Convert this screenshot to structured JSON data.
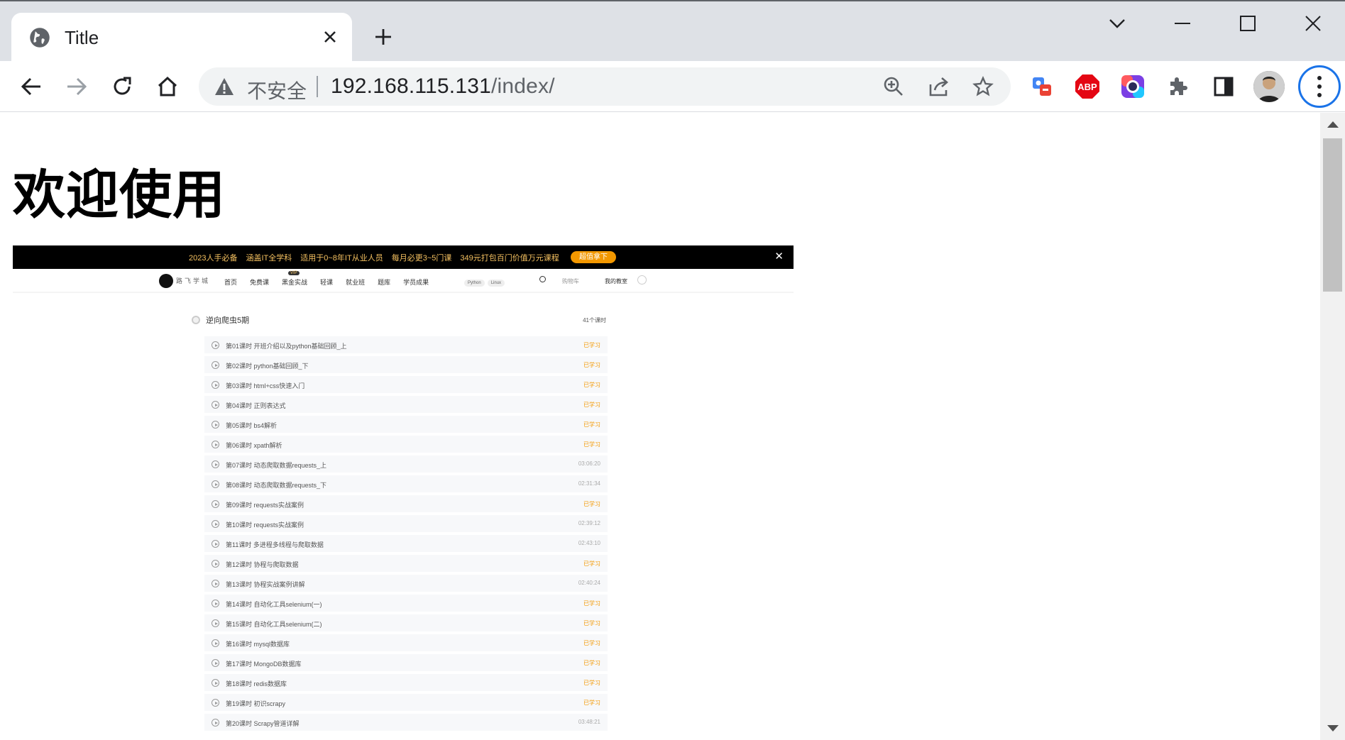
{
  "browser": {
    "tab_title": "Title",
    "omnibox": {
      "security_label": "不安全",
      "url_host": "192.168.115.131",
      "url_path": "/index/"
    },
    "extensions": [
      "translate-extension-icon",
      "adblock-plus-icon",
      "screen-capture-extension-icon",
      "extensions-puzzle-icon"
    ],
    "ext_abp_label": "ABP"
  },
  "page": {
    "heading": "欢迎使用",
    "embedded": {
      "promo": {
        "items": [
          "2023人手必备",
          "涵盖IT全学科",
          "适用于0~8年IT从业人员",
          "每月必更3~5门课",
          "349元打包百门价值万元课程"
        ],
        "cta": "超值拿下",
        "close": "✕"
      },
      "nav": {
        "logo_text": "路飞学城",
        "menu": [
          "首页",
          "免费课",
          "黑金实战",
          "轻课",
          "就业班",
          "题库",
          "学员成果"
        ],
        "vip": "VIP",
        "search_chips": [
          "Python",
          "Linux"
        ],
        "cart": "购物车",
        "my_classroom": "我的教室"
      },
      "course": {
        "title": "逆向爬虫5期",
        "count": "41个课时",
        "lessons": [
          {
            "title": "第01课时 开班介绍以及python基础回顾_上",
            "status": "已学习",
            "done": true
          },
          {
            "title": "第02课时 python基础回顾_下",
            "status": "已学习",
            "done": true
          },
          {
            "title": "第03课时 html+css快速入门",
            "status": "已学习",
            "done": true
          },
          {
            "title": "第04课时 正则表达式",
            "status": "已学习",
            "done": true
          },
          {
            "title": "第05课时 bs4解析",
            "status": "已学习",
            "done": true
          },
          {
            "title": "第06课时 xpath解析",
            "status": "已学习",
            "done": true
          },
          {
            "title": "第07课时 动态爬取数据requests_上",
            "status": "03:06:20",
            "done": false
          },
          {
            "title": "第08课时 动态爬取数据requests_下",
            "status": "02:31:34",
            "done": false
          },
          {
            "title": "第09课时 requests实战案例",
            "status": "已学习",
            "done": true
          },
          {
            "title": "第10课时 requests实战案例",
            "status": "02:39:12",
            "done": false
          },
          {
            "title": "第11课时 多进程多线程与爬取数据",
            "status": "02:43:10",
            "done": false
          },
          {
            "title": "第12课时 协程与爬取数据",
            "status": "已学习",
            "done": true
          },
          {
            "title": "第13课时 协程实战案例讲解",
            "status": "02:40:24",
            "done": false
          },
          {
            "title": "第14课时 自动化工具selenium(一)",
            "status": "已学习",
            "done": true
          },
          {
            "title": "第15课时 自动化工具selenium(二)",
            "status": "已学习",
            "done": true
          },
          {
            "title": "第16课时 mysql数据库",
            "status": "已学习",
            "done": true
          },
          {
            "title": "第17课时 MongoDB数据库",
            "status": "已学习",
            "done": true
          },
          {
            "title": "第18课时 redis数据库",
            "status": "已学习",
            "done": true
          },
          {
            "title": "第19课时 初识scrapy",
            "status": "已学习",
            "done": true
          },
          {
            "title": "第20课时 Scrapy管道详解",
            "status": "03:48:21",
            "done": false
          }
        ]
      }
    }
  }
}
